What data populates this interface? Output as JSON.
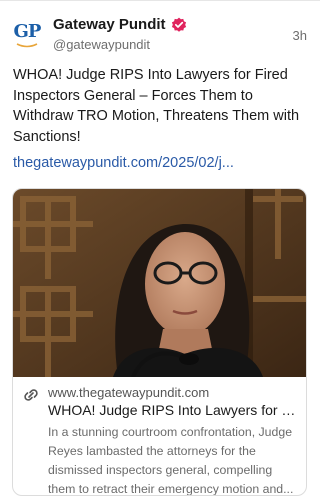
{
  "author": {
    "display_name": "Gateway Pundit",
    "handle": "@gatewaypundit",
    "avatar_letters": "GP",
    "verified": true,
    "verified_color": "#e0245e"
  },
  "post": {
    "time": "3h",
    "text": "WHOA! Judge RIPS Into Lawyers for Fired Inspectors General – Forces Them to Withdraw TRO Motion, Threatens Them with Sanctions!",
    "link_text": "thegatewaypundit.com/2025/02/j..."
  },
  "card": {
    "image_description": "photo of a woman with glasses speaking at a microphone",
    "domain": "www.thegatewaypundit.com",
    "title": "WHOA! Judge RIPS Into Lawyers for F...",
    "description": "In a stunning courtroom confrontation, Judge Reyes lambasted the attorneys for the dismissed inspectors general, compelling them to retract their emergency motion and..."
  },
  "colors": {
    "link": "#2a5aa7",
    "brand_blue": "#1c5fa8",
    "secondary_text": "#6e6e6e"
  }
}
